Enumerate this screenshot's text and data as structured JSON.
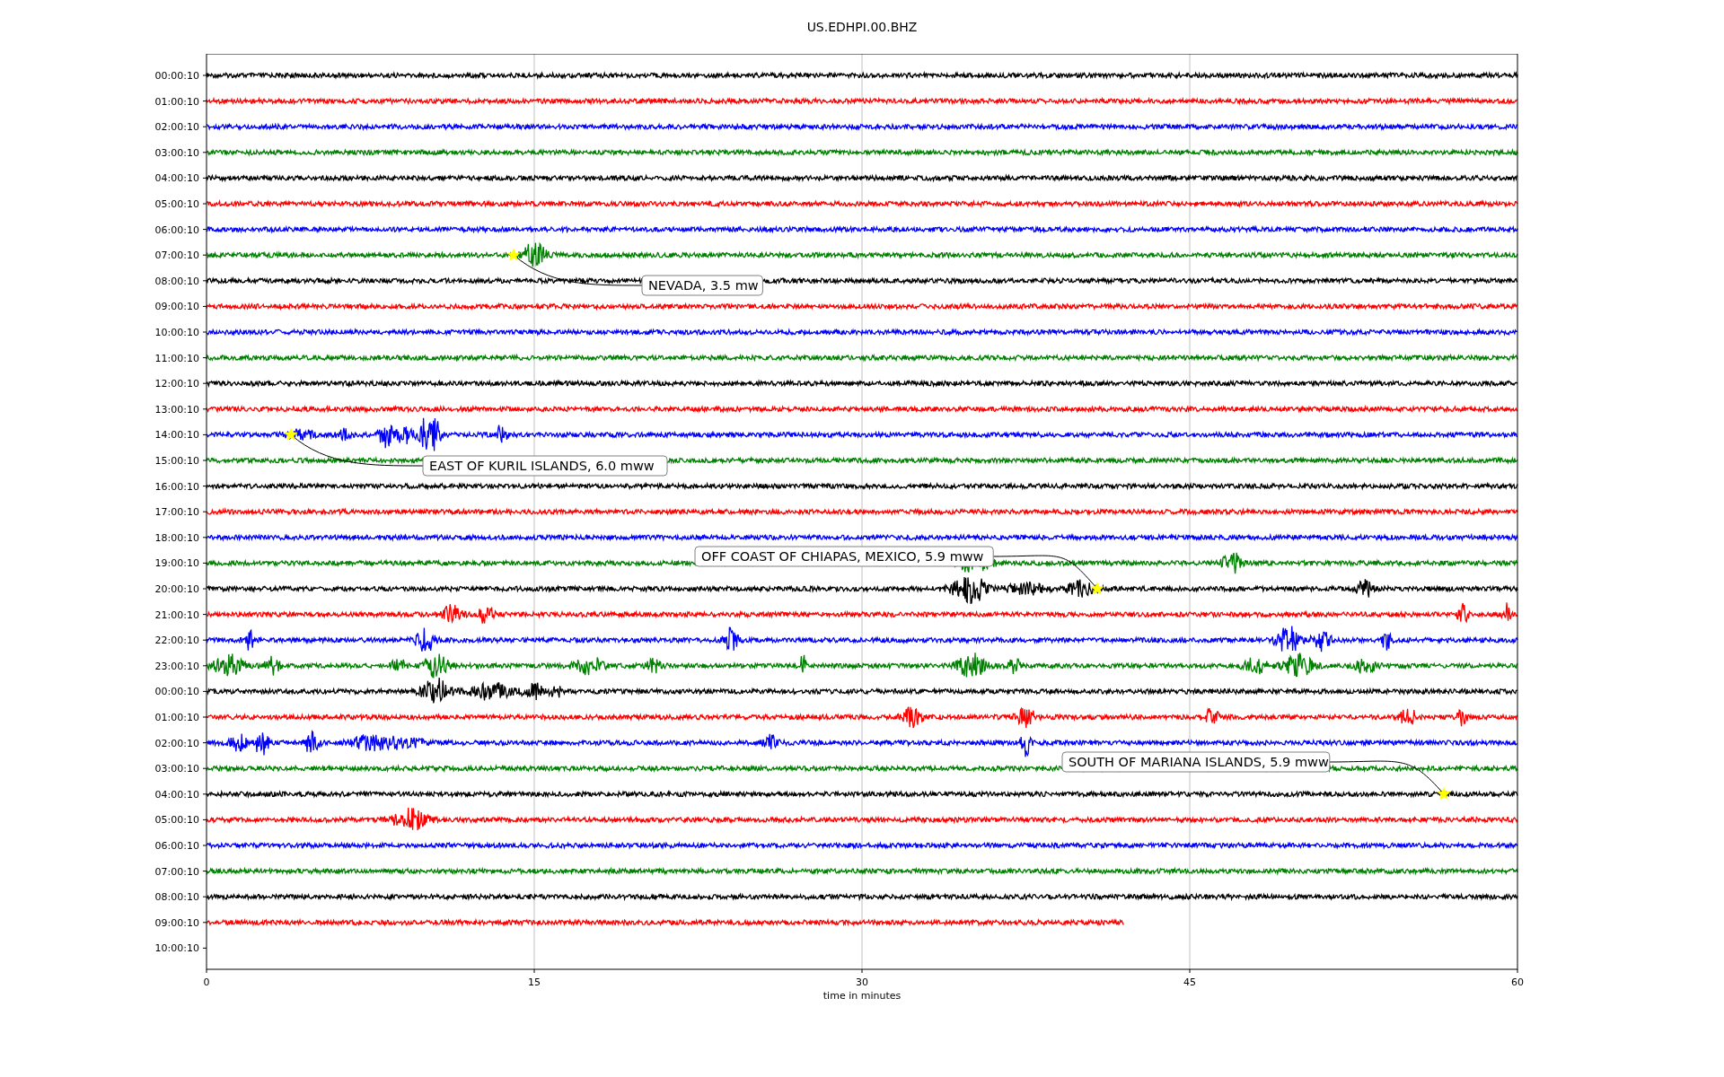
{
  "title": "US.EDHPI.00.BHZ",
  "rows": [
    {
      "label": "00:00:10",
      "color": "#000000",
      "kind": "full"
    },
    {
      "label": "01:00:10",
      "color": "#ff0000",
      "kind": "full"
    },
    {
      "label": "02:00:10",
      "color": "#0000ff",
      "kind": "full"
    },
    {
      "label": "03:00:10",
      "color": "#008000",
      "kind": "full"
    },
    {
      "label": "04:00:10",
      "color": "#000000",
      "kind": "full"
    },
    {
      "label": "05:00:10",
      "color": "#ff0000",
      "kind": "full"
    },
    {
      "label": "06:00:10",
      "color": "#0000ff",
      "kind": "full"
    },
    {
      "label": "07:00:10",
      "color": "#008000",
      "kind": "full",
      "event": "NEVADA, 3.5 mw"
    },
    {
      "label": "08:00:10",
      "color": "#000000",
      "kind": "full"
    },
    {
      "label": "09:00:10",
      "color": "#ff0000",
      "kind": "full"
    },
    {
      "label": "10:00:10",
      "color": "#0000ff",
      "kind": "full"
    },
    {
      "label": "11:00:10",
      "color": "#008000",
      "kind": "full"
    },
    {
      "label": "12:00:10",
      "color": "#000000",
      "kind": "full"
    },
    {
      "label": "13:00:10",
      "color": "#ff0000",
      "kind": "full"
    },
    {
      "label": "14:00:10",
      "color": "#0000ff",
      "kind": "full",
      "event": "EAST OF KURIL ISLANDS, 6.0 mww"
    },
    {
      "label": "15:00:10",
      "color": "#008000",
      "kind": "full"
    },
    {
      "label": "16:00:10",
      "color": "#000000",
      "kind": "full"
    },
    {
      "label": "17:00:10",
      "color": "#ff0000",
      "kind": "full"
    },
    {
      "label": "18:00:10",
      "color": "#0000ff",
      "kind": "full"
    },
    {
      "label": "19:00:10",
      "color": "#008000",
      "kind": "full"
    },
    {
      "label": "20:00:10",
      "color": "#000000",
      "kind": "full",
      "event": "OFF COAST OF CHIAPAS, MEXICO, 5.9 mww"
    },
    {
      "label": "21:00:10",
      "color": "#ff0000",
      "kind": "full"
    },
    {
      "label": "22:00:10",
      "color": "#0000ff",
      "kind": "full"
    },
    {
      "label": "23:00:10",
      "color": "#008000",
      "kind": "full"
    },
    {
      "label": "00:00:10",
      "color": "#000000",
      "kind": "full"
    },
    {
      "label": "01:00:10",
      "color": "#ff0000",
      "kind": "full"
    },
    {
      "label": "02:00:10",
      "color": "#0000ff",
      "kind": "full"
    },
    {
      "label": "03:00:10",
      "color": "#008000",
      "kind": "full"
    },
    {
      "label": "04:00:10",
      "color": "#000000",
      "kind": "full",
      "event": "SOUTH OF MARIANA ISLANDS, 5.9 mww"
    },
    {
      "label": "05:00:10",
      "color": "#ff0000",
      "kind": "full"
    },
    {
      "label": "06:00:10",
      "color": "#0000ff",
      "kind": "full"
    },
    {
      "label": "07:00:10",
      "color": "#008000",
      "kind": "full"
    },
    {
      "label": "08:00:10",
      "color": "#000000",
      "kind": "full"
    },
    {
      "label": "09:00:10",
      "color": "#ff0000",
      "kind": "partial"
    },
    {
      "label": "10:00:10",
      "kind": "empty"
    }
  ],
  "xticks": [
    "0",
    "15",
    "30",
    "45",
    "60"
  ],
  "xlabel": "time in minutes"
}
